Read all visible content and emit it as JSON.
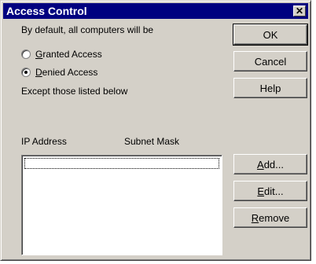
{
  "window": {
    "title": "Access Control",
    "close_glyph": "✕"
  },
  "intro_text": "By default, all computers will be",
  "options": [
    {
      "prefix": "",
      "accel": "G",
      "rest": "ranted Access",
      "checked": false
    },
    {
      "prefix": "",
      "accel": "D",
      "rest": "enied Access",
      "checked": true
    }
  ],
  "except_text": "Except those listed below",
  "columns": {
    "ip": "IP Address",
    "mask": "Subnet Mask"
  },
  "list": {
    "rows": []
  },
  "buttons": {
    "ok": "OK",
    "cancel": "Cancel",
    "help": "Help",
    "add": {
      "accel": "A",
      "rest": "dd..."
    },
    "edit": {
      "accel": "E",
      "rest": "dit..."
    },
    "remove": {
      "accel": "R",
      "rest": "emove"
    }
  }
}
